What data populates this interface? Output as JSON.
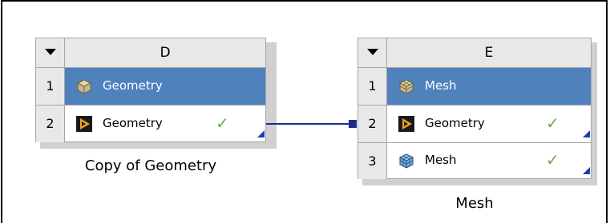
{
  "systems": [
    {
      "header": "D",
      "caption": "Copy of Geometry",
      "rows": [
        {
          "num": "1",
          "label": "Geometry",
          "icon": "geometry-block-icon",
          "selected": true,
          "status": ""
        },
        {
          "num": "2",
          "label": "Geometry",
          "icon": "geometry-cell-icon",
          "selected": false,
          "status": "check"
        }
      ]
    },
    {
      "header": "E",
      "caption": "Mesh",
      "rows": [
        {
          "num": "1",
          "label": "Mesh",
          "icon": "mesh-block-icon",
          "selected": true,
          "status": ""
        },
        {
          "num": "2",
          "label": "Geometry",
          "icon": "geometry-cell-icon",
          "selected": false,
          "status": "check"
        },
        {
          "num": "3",
          "label": "Mesh",
          "icon": "mesh-cell-icon",
          "selected": false,
          "status": "check"
        }
      ]
    }
  ],
  "colors": {
    "selected_row": "#4f81bd",
    "check": "#6aa84f",
    "connector": "#1f2a8a"
  }
}
